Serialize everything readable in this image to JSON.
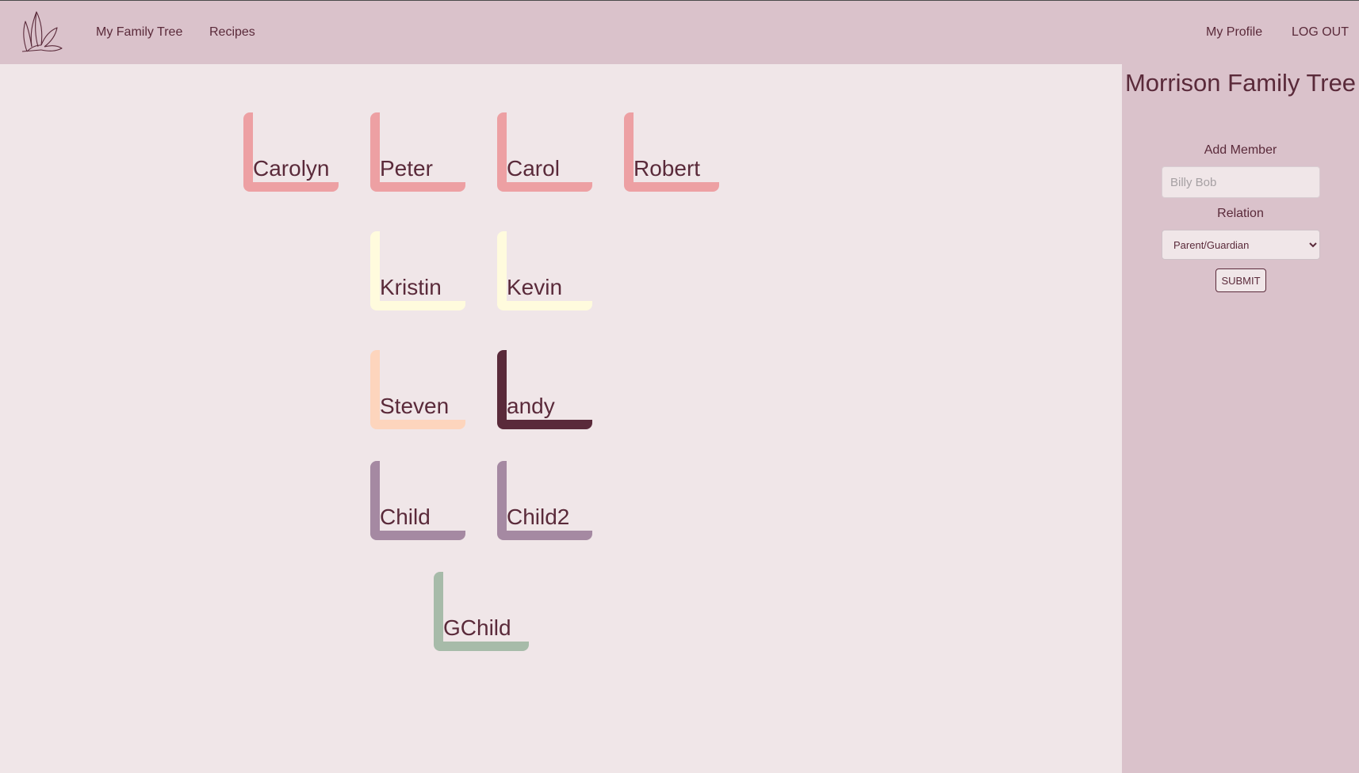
{
  "nav": {
    "links": [
      "My Family Tree",
      "Recipes"
    ],
    "right_links": [
      "My Profile",
      "LOG OUT"
    ]
  },
  "sidebar": {
    "title": "Morrison Family Tree",
    "add_member_label": "Add Member",
    "name_placeholder": "Billy Bob",
    "relation_label": "Relation",
    "relation_selected": "Parent/Guardian",
    "submit_label": "SUBMIT"
  },
  "members": [
    {
      "name": "Carolyn",
      "color": "#eda0a3"
    },
    {
      "name": "Peter",
      "color": "#eda0a3"
    },
    {
      "name": "Carol",
      "color": "#eda0a3"
    },
    {
      "name": "Robert",
      "color": "#eda0a3"
    },
    {
      "name": "Kristin",
      "color": "#fffbdd"
    },
    {
      "name": "Kevin",
      "color": "#fffbdd"
    },
    {
      "name": "Steven",
      "color": "#fdd5bd"
    },
    {
      "name": "andy",
      "color": "#5a2a3a"
    },
    {
      "name": "Child",
      "color": "#a589a2"
    },
    {
      "name": "Child2",
      "color": "#a589a2"
    },
    {
      "name": "GChild",
      "color": "#a7bba9"
    }
  ],
  "colors": {
    "navbar": "#dac2cb",
    "background": "#f0e6e8",
    "text": "#5a2a3a"
  }
}
